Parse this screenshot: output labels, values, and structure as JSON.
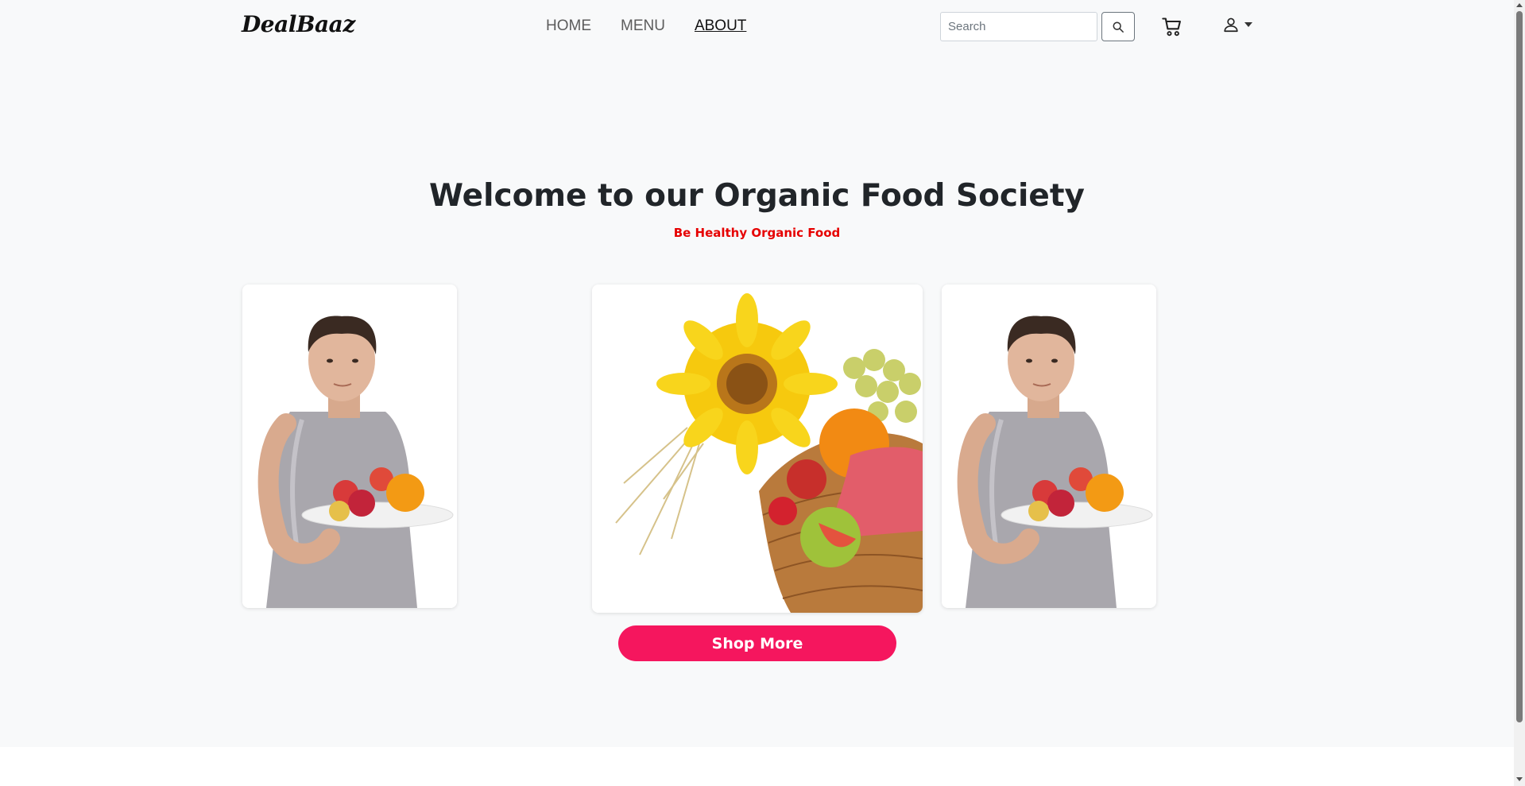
{
  "brand": {
    "logo_text": "DealBaaz"
  },
  "nav": {
    "items": [
      {
        "label": "HOME",
        "active": false
      },
      {
        "label": "MENU",
        "active": false
      },
      {
        "label": "ABOUT",
        "active": true
      }
    ]
  },
  "search": {
    "placeholder": "Search",
    "value": ""
  },
  "icons": {
    "search": "search-icon",
    "cart": "cart-icon",
    "user": "user-icon",
    "dropdown": "caret-down-icon"
  },
  "hero": {
    "title": "Welcome to our Organic Food Society",
    "subtitle": "Be Healthy Organic Food"
  },
  "cards": [
    {
      "image": "man-with-fruit-plate"
    },
    {
      "image": "sunflower-fruit-basket"
    },
    {
      "image": "man-with-fruit-plate"
    }
  ],
  "cta": {
    "label": "Shop More"
  },
  "colors": {
    "accent": "#f5165e",
    "subtitle": "#e60000",
    "background": "#f8f9fa"
  }
}
